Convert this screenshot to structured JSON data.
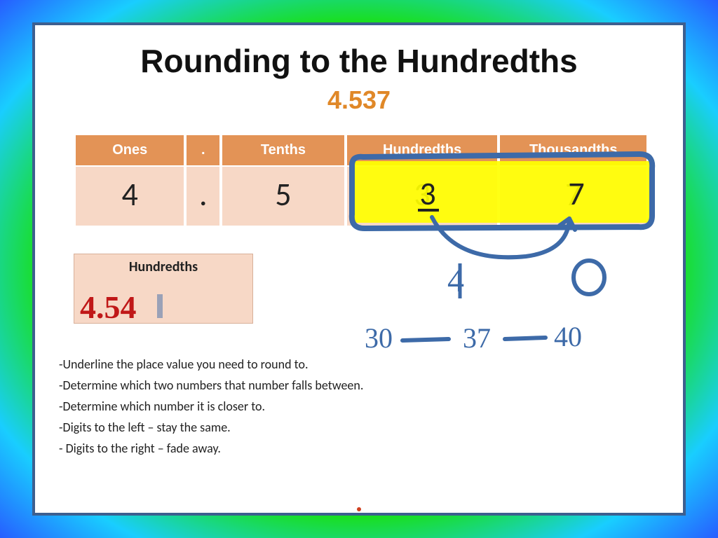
{
  "title": "Rounding to the Hundredths",
  "number": "4.537",
  "columns": {
    "ones": "Ones",
    "dot": ".",
    "tenths": "Tenths",
    "hundredths": "Hundredths",
    "thousandths": "Thousandths"
  },
  "digits": {
    "ones": "4",
    "dot": ".",
    "tenths": "5",
    "hundredths": "3",
    "thousandths": "7"
  },
  "answer_box": {
    "label": "Hundredths",
    "value": "4.54"
  },
  "handwriting": {
    "below_hundredths": "4",
    "below_thousandths": "0",
    "range_left": "30",
    "range_mid": "37",
    "range_right": "40"
  },
  "rules": [
    "-Underline the place value you need to round to.",
    "-Determine which two numbers that number falls between.",
    "-Determine which number it is closer to.",
    "-Digits to the left – stay the same.",
    "- Digits to the right – fade away."
  ]
}
